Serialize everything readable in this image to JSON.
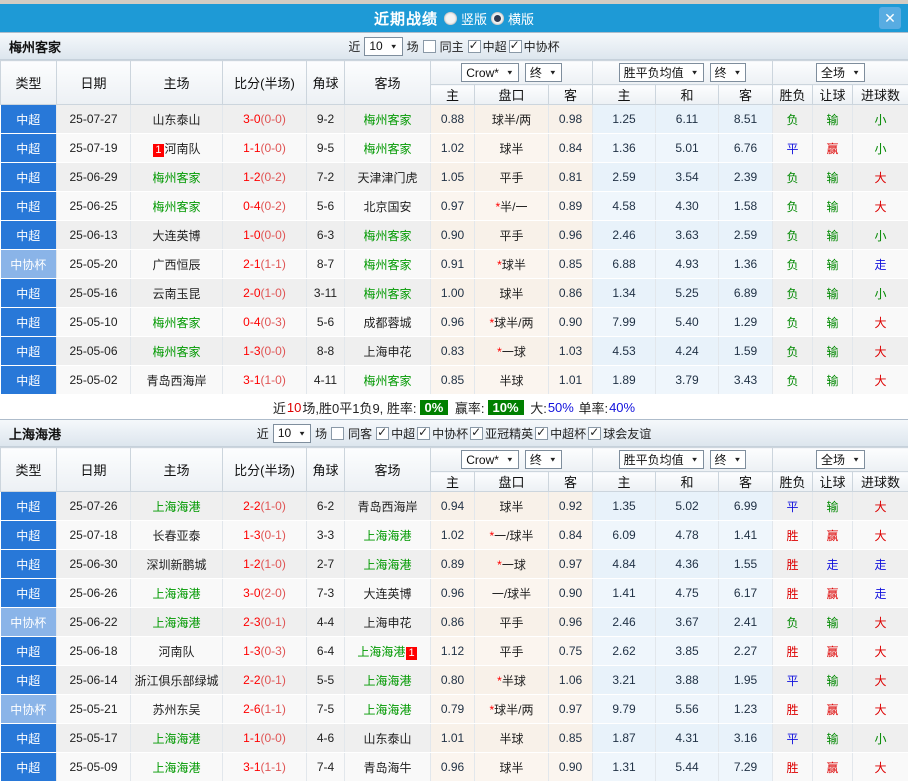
{
  "titlebar": {
    "title": "近期战绩",
    "close_glyph": "✕",
    "radios": [
      {
        "label": "竖版",
        "selected": false
      },
      {
        "label": "横版",
        "selected": true
      }
    ]
  },
  "table_header": {
    "main": [
      "类型",
      "日期",
      "主场",
      "比分(半场)",
      "角球",
      "客场"
    ],
    "sub": [
      "主",
      "盘口",
      "客",
      "主",
      "和",
      "客",
      "胜负",
      "让球",
      "进球数"
    ],
    "dropdowns": {
      "company": "Crow*",
      "company_stage": "终",
      "europe": "胜平负均值",
      "europe_stage": "终",
      "scope": "全场"
    }
  },
  "colors": {
    "accent_blue": "#1e9ad6",
    "league_super": "#2878d8",
    "league_cup": "#8ab4e8",
    "win_red": "#dd0000",
    "draw_blue": "#1111dd",
    "lose_green": "#008800",
    "score_red": "#ff0000",
    "summary_badge_bg": "#008000"
  },
  "sections": [
    {
      "team": "梅州客家",
      "filter": {
        "near_label": "近",
        "count": "10",
        "games_label": "场",
        "same_label": "同主",
        "same_checked": false,
        "leagues": [
          {
            "label": "中超",
            "checked": true
          },
          {
            "label": "中协杯",
            "checked": true
          }
        ]
      },
      "rows": [
        {
          "type": "中超",
          "date": "25-07-27",
          "home": "山东泰山",
          "home_badge": "",
          "score": "3-0",
          "half": "(0-0)",
          "corner": "9-2",
          "away": "梅州客家",
          "away_badge": "",
          "o_home": "0.88",
          "handicap": "球半/两",
          "o_away": "0.98",
          "e_home": "1.25",
          "e_draw": "6.11",
          "e_away": "8.51",
          "result": "负",
          "handicap_result": "输",
          "goals": "小"
        },
        {
          "type": "中超",
          "date": "25-07-19",
          "home": "河南队",
          "home_badge": "1",
          "score": "1-1",
          "half": "(0-0)",
          "corner": "9-5",
          "away": "梅州客家",
          "away_badge": "",
          "o_home": "1.02",
          "handicap": "球半",
          "o_away": "0.84",
          "e_home": "1.36",
          "e_draw": "5.01",
          "e_away": "6.76",
          "result": "平",
          "handicap_result": "赢",
          "goals": "小"
        },
        {
          "type": "中超",
          "date": "25-06-29",
          "home": "梅州客家",
          "home_badge": "",
          "score": "1-2",
          "half": "(0-2)",
          "corner": "7-2",
          "away": "天津津门虎",
          "away_badge": "",
          "o_home": "1.05",
          "handicap": "平手",
          "o_away": "0.81",
          "e_home": "2.59",
          "e_draw": "3.54",
          "e_away": "2.39",
          "result": "负",
          "handicap_result": "输",
          "goals": "大"
        },
        {
          "type": "中超",
          "date": "25-06-25",
          "home": "梅州客家",
          "home_badge": "",
          "score": "0-4",
          "half": "(0-2)",
          "corner": "5-6",
          "away": "北京国安",
          "away_badge": "",
          "o_home": "0.97",
          "handicap": "*半/一",
          "o_away": "0.89",
          "e_home": "4.58",
          "e_draw": "4.30",
          "e_away": "1.58",
          "result": "负",
          "handicap_result": "输",
          "goals": "大"
        },
        {
          "type": "中超",
          "date": "25-06-13",
          "home": "大连英博",
          "home_badge": "",
          "score": "1-0",
          "half": "(0-0)",
          "corner": "6-3",
          "away": "梅州客家",
          "away_badge": "",
          "o_home": "0.90",
          "handicap": "平手",
          "o_away": "0.96",
          "e_home": "2.46",
          "e_draw": "3.63",
          "e_away": "2.59",
          "result": "负",
          "handicap_result": "输",
          "goals": "小"
        },
        {
          "type": "中协杯",
          "date": "25-05-20",
          "home": "广西恒辰",
          "home_badge": "",
          "score": "2-1",
          "half": "(1-1)",
          "corner": "8-7",
          "away": "梅州客家",
          "away_badge": "",
          "o_home": "0.91",
          "handicap": "*球半",
          "o_away": "0.85",
          "e_home": "6.88",
          "e_draw": "4.93",
          "e_away": "1.36",
          "result": "负",
          "handicap_result": "输",
          "goals": "走"
        },
        {
          "type": "中超",
          "date": "25-05-16",
          "home": "云南玉昆",
          "home_badge": "",
          "score": "2-0",
          "half": "(1-0)",
          "corner": "3-11",
          "away": "梅州客家",
          "away_badge": "",
          "o_home": "1.00",
          "handicap": "球半",
          "o_away": "0.86",
          "e_home": "1.34",
          "e_draw": "5.25",
          "e_away": "6.89",
          "result": "负",
          "handicap_result": "输",
          "goals": "小"
        },
        {
          "type": "中超",
          "date": "25-05-10",
          "home": "梅州客家",
          "home_badge": "",
          "score": "0-4",
          "half": "(0-3)",
          "corner": "5-6",
          "away": "成都蓉城",
          "away_badge": "",
          "o_home": "0.96",
          "handicap": "*球半/两",
          "o_away": "0.90",
          "e_home": "7.99",
          "e_draw": "5.40",
          "e_away": "1.29",
          "result": "负",
          "handicap_result": "输",
          "goals": "大"
        },
        {
          "type": "中超",
          "date": "25-05-06",
          "home": "梅州客家",
          "home_badge": "",
          "score": "1-3",
          "half": "(0-0)",
          "corner": "8-8",
          "away": "上海申花",
          "away_badge": "",
          "o_home": "0.83",
          "handicap": "*一球",
          "o_away": "1.03",
          "e_home": "4.53",
          "e_draw": "4.24",
          "e_away": "1.59",
          "result": "负",
          "handicap_result": "输",
          "goals": "大"
        },
        {
          "type": "中超",
          "date": "25-05-02",
          "home": "青岛西海岸",
          "home_badge": "",
          "score": "3-1",
          "half": "(1-0)",
          "corner": "4-11",
          "away": "梅州客家",
          "away_badge": "",
          "o_home": "0.85",
          "handicap": "半球",
          "o_away": "1.01",
          "e_home": "1.89",
          "e_draw": "3.79",
          "e_away": "3.43",
          "result": "负",
          "handicap_result": "输",
          "goals": "大"
        }
      ],
      "summary": [
        {
          "text": "近"
        },
        {
          "text": "10",
          "style": "red"
        },
        {
          "text": "场,胜0平1负9, 胜率:"
        },
        {
          "text": "0%",
          "style": "badge"
        },
        {
          "text": " 赢率:"
        },
        {
          "text": "10%",
          "style": "badge"
        },
        {
          "text": " 大:"
        },
        {
          "text": "50%",
          "style": "blue"
        },
        {
          "text": " 单率:"
        },
        {
          "text": "40%",
          "style": "blue"
        }
      ]
    },
    {
      "team": "上海海港",
      "filter": {
        "near_label": "近",
        "count": "10",
        "games_label": "场",
        "same_label": "同客",
        "same_checked": false,
        "leagues": [
          {
            "label": "中超",
            "checked": true
          },
          {
            "label": "中协杯",
            "checked": true
          },
          {
            "label": "亚冠精英",
            "checked": true
          },
          {
            "label": "中超杯",
            "checked": true
          },
          {
            "label": "球会友谊",
            "checked": true
          }
        ]
      },
      "rows": [
        {
          "type": "中超",
          "date": "25-07-26",
          "home": "上海海港",
          "home_badge": "",
          "score": "2-2",
          "half": "(1-0)",
          "corner": "6-2",
          "away": "青岛西海岸",
          "away_badge": "",
          "o_home": "0.94",
          "handicap": "球半",
          "o_away": "0.92",
          "e_home": "1.35",
          "e_draw": "5.02",
          "e_away": "6.99",
          "result": "平",
          "handicap_result": "输",
          "goals": "大"
        },
        {
          "type": "中超",
          "date": "25-07-18",
          "home": "长春亚泰",
          "home_badge": "",
          "score": "1-3",
          "half": "(0-1)",
          "corner": "3-3",
          "away": "上海海港",
          "away_badge": "",
          "o_home": "1.02",
          "handicap": "*一/球半",
          "o_away": "0.84",
          "e_home": "6.09",
          "e_draw": "4.78",
          "e_away": "1.41",
          "result": "胜",
          "handicap_result": "赢",
          "goals": "大"
        },
        {
          "type": "中超",
          "date": "25-06-30",
          "home": "深圳新鹏城",
          "home_badge": "",
          "score": "1-2",
          "half": "(1-0)",
          "corner": "2-7",
          "away": "上海海港",
          "away_badge": "",
          "o_home": "0.89",
          "handicap": "*一球",
          "o_away": "0.97",
          "e_home": "4.84",
          "e_draw": "4.36",
          "e_away": "1.55",
          "result": "胜",
          "handicap_result": "走",
          "goals": "走"
        },
        {
          "type": "中超",
          "date": "25-06-26",
          "home": "上海海港",
          "home_badge": "",
          "score": "3-0",
          "half": "(2-0)",
          "corner": "7-3",
          "away": "大连英博",
          "away_badge": "",
          "o_home": "0.96",
          "handicap": "一/球半",
          "o_away": "0.90",
          "e_home": "1.41",
          "e_draw": "4.75",
          "e_away": "6.17",
          "result": "胜",
          "handicap_result": "赢",
          "goals": "走"
        },
        {
          "type": "中协杯",
          "date": "25-06-22",
          "home": "上海海港",
          "home_badge": "",
          "score": "2-3",
          "half": "(0-1)",
          "corner": "4-4",
          "away": "上海申花",
          "away_badge": "",
          "o_home": "0.86",
          "handicap": "平手",
          "o_away": "0.96",
          "e_home": "2.46",
          "e_draw": "3.67",
          "e_away": "2.41",
          "result": "负",
          "handicap_result": "输",
          "goals": "大"
        },
        {
          "type": "中超",
          "date": "25-06-18",
          "home": "河南队",
          "home_badge": "",
          "score": "1-3",
          "half": "(0-3)",
          "corner": "6-4",
          "away": "上海海港",
          "away_badge": "1",
          "o_home": "1.12",
          "handicap": "平手",
          "o_away": "0.75",
          "e_home": "2.62",
          "e_draw": "3.85",
          "e_away": "2.27",
          "result": "胜",
          "handicap_result": "赢",
          "goals": "大"
        },
        {
          "type": "中超",
          "date": "25-06-14",
          "home": "浙江俱乐部绿城",
          "home_badge": "",
          "score": "2-2",
          "half": "(0-1)",
          "corner": "5-5",
          "away": "上海海港",
          "away_badge": "",
          "o_home": "0.80",
          "handicap": "*半球",
          "o_away": "1.06",
          "e_home": "3.21",
          "e_draw": "3.88",
          "e_away": "1.95",
          "result": "平",
          "handicap_result": "输",
          "goals": "大"
        },
        {
          "type": "中协杯",
          "date": "25-05-21",
          "home": "苏州东吴",
          "home_badge": "",
          "score": "2-6",
          "half": "(1-1)",
          "corner": "7-5",
          "away": "上海海港",
          "away_badge": "",
          "o_home": "0.79",
          "handicap": "*球半/两",
          "o_away": "0.97",
          "e_home": "9.79",
          "e_draw": "5.56",
          "e_away": "1.23",
          "result": "胜",
          "handicap_result": "赢",
          "goals": "大"
        },
        {
          "type": "中超",
          "date": "25-05-17",
          "home": "上海海港",
          "home_badge": "",
          "score": "1-1",
          "half": "(0-0)",
          "corner": "4-6",
          "away": "山东泰山",
          "away_badge": "",
          "o_home": "1.01",
          "handicap": "半球",
          "o_away": "0.85",
          "e_home": "1.87",
          "e_draw": "4.31",
          "e_away": "3.16",
          "result": "平",
          "handicap_result": "输",
          "goals": "小"
        },
        {
          "type": "中超",
          "date": "25-05-09",
          "home": "上海海港",
          "home_badge": "",
          "score": "3-1",
          "half": "(1-1)",
          "corner": "7-4",
          "away": "青岛海牛",
          "away_badge": "",
          "o_home": "0.96",
          "handicap": "球半",
          "o_away": "0.90",
          "e_home": "1.31",
          "e_draw": "5.44",
          "e_away": "7.29",
          "result": "胜",
          "handicap_result": "赢",
          "goals": "大"
        }
      ],
      "summary": null
    }
  ]
}
